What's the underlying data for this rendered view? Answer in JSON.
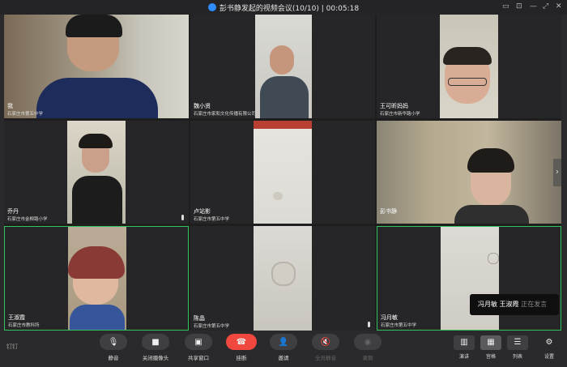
{
  "window": {
    "title": "彭书静发起的视频会议(10/10)",
    "divider": "|",
    "timer": "00:05:18"
  },
  "participants": [
    {
      "name": "我",
      "org": "石家庄市第五中学",
      "active": false,
      "muted": false
    },
    {
      "name": "魏小贤",
      "org": "石家庄市家和文化传播有限公司",
      "active": false,
      "muted": false
    },
    {
      "name": "王可昕妈妈",
      "org": "石家庄市新华路小学",
      "active": false,
      "muted": false
    },
    {
      "name": "乔丹",
      "org": "石家庄市金柳路小学",
      "active": false,
      "muted": true
    },
    {
      "name": "卢站影",
      "org": "石家庄市第五中学",
      "active": false,
      "muted": false
    },
    {
      "name": "彭书静",
      "org": "",
      "active": false,
      "muted": false
    },
    {
      "name": "王淑霞",
      "org": "石家庄市教科所",
      "active": true,
      "muted": false
    },
    {
      "name": "陈晶",
      "org": "石家庄市第五中学",
      "active": false,
      "muted": true
    },
    {
      "name": "冯月敏",
      "org": "石家庄市第五中学",
      "active": true,
      "muted": false
    }
  ],
  "speaking_toast": {
    "names": "冯月敏  王淑霞",
    "status": "正在发言"
  },
  "toolbar": {
    "brand": "钉钉",
    "mute": "静音",
    "camera": "关闭摄像头",
    "share": "共享窗口",
    "hangup": "挂断",
    "invite": "邀请",
    "mute_all": "全员静音",
    "record": "录制"
  },
  "views": {
    "speaker": "演讲",
    "gallery": "宫格",
    "list": "列表",
    "settings": "设置"
  },
  "colors": {
    "active_border": "#33c35d",
    "hangup": "#f0483e",
    "logo": "#2f8cff"
  }
}
